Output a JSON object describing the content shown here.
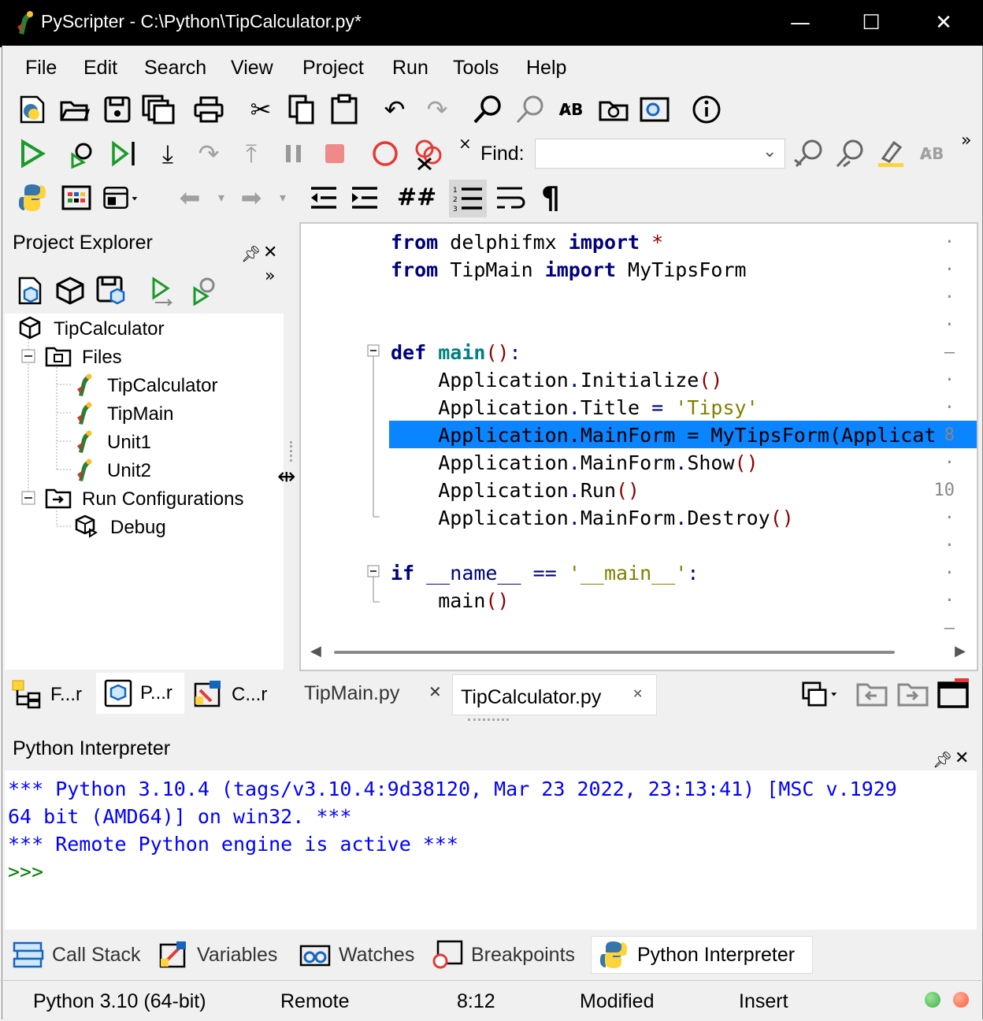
{
  "window": {
    "title": "PyScripter - C:\\Python\\TipCalculator.py*",
    "minimize": "—",
    "maximize": "☐",
    "close": "✕"
  },
  "menu": [
    "File",
    "Edit",
    "Search",
    "View",
    "Project",
    "Run",
    "Tools",
    "Help"
  ],
  "toolbar": {
    "find_label": "Find:",
    "find_value": "",
    "overflow": "»",
    "close": "×"
  },
  "project_explorer": {
    "title": "Project Explorer",
    "overflow": "»",
    "tree": {
      "root": "TipCalculator",
      "files_folder": "Files",
      "files": [
        "TipCalculator",
        "TipMain",
        "Unit1",
        "Unit2"
      ],
      "run_folder": "Run Configurations",
      "run_items": [
        "Debug"
      ]
    },
    "tabs": [
      "F...r",
      "P...r",
      "C...r"
    ]
  },
  "editor": {
    "lines": [
      {
        "no": "·",
        "html_parts": [
          [
            "kw",
            "from"
          ],
          [
            "t",
            " delphifmx "
          ],
          [
            "kw",
            "import"
          ],
          [
            "t",
            " "
          ],
          [
            "paren",
            "*"
          ]
        ]
      },
      {
        "no": "·",
        "html_parts": [
          [
            "kw",
            "from"
          ],
          [
            "t",
            " TipMain "
          ],
          [
            "kw",
            "import"
          ],
          [
            "t",
            " MyTipsForm"
          ]
        ]
      },
      {
        "no": "·",
        "html_parts": []
      },
      {
        "no": "·",
        "html_parts": []
      },
      {
        "no": "–",
        "html_parts": [
          [
            "kw",
            "def"
          ],
          [
            "t",
            " "
          ],
          [
            "fn",
            "main"
          ],
          [
            "paren",
            "()"
          ],
          [
            "op",
            ":"
          ]
        ]
      },
      {
        "no": "·",
        "html_parts": [
          [
            "t",
            "    Application"
          ],
          [
            "op",
            "."
          ],
          [
            "t",
            "Initialize"
          ],
          [
            "paren",
            "()"
          ]
        ]
      },
      {
        "no": "·",
        "html_parts": [
          [
            "t",
            "    Application"
          ],
          [
            "op",
            "."
          ],
          [
            "t",
            "Title "
          ],
          [
            "op",
            "="
          ],
          [
            "t",
            " "
          ],
          [
            "str",
            "'Tipsy'"
          ]
        ]
      },
      {
        "no": "8",
        "html_parts": [
          [
            "t",
            "    Application"
          ],
          [
            "op",
            "."
          ],
          [
            "t",
            "MainForm "
          ],
          [
            "op",
            "="
          ],
          [
            "t",
            " MyTipsForm"
          ],
          [
            "paren",
            "("
          ],
          [
            "t",
            "Applicat"
          ]
        ]
      },
      {
        "no": "·",
        "html_parts": [
          [
            "t",
            "    Application"
          ],
          [
            "op",
            "."
          ],
          [
            "t",
            "MainForm"
          ],
          [
            "op",
            "."
          ],
          [
            "t",
            "Show"
          ],
          [
            "paren",
            "()"
          ]
        ]
      },
      {
        "no": "10",
        "html_parts": [
          [
            "t",
            "    Application"
          ],
          [
            "op",
            "."
          ],
          [
            "t",
            "Run"
          ],
          [
            "paren",
            "()"
          ]
        ]
      },
      {
        "no": "·",
        "html_parts": [
          [
            "t",
            "    Application"
          ],
          [
            "op",
            "."
          ],
          [
            "t",
            "MainForm"
          ],
          [
            "op",
            "."
          ],
          [
            "t",
            "Destroy"
          ],
          [
            "paren",
            "()"
          ]
        ]
      },
      {
        "no": "·",
        "html_parts": []
      },
      {
        "no": "·",
        "html_parts": [
          [
            "kw",
            "if"
          ],
          [
            "t",
            " "
          ],
          [
            "op",
            "__name__"
          ],
          [
            "t",
            " "
          ],
          [
            "op",
            "=="
          ],
          [
            "t",
            " "
          ],
          [
            "str",
            "'__main__'"
          ],
          [
            "op",
            ":"
          ]
        ]
      },
      {
        "no": "·",
        "html_parts": [
          [
            "t",
            "    main"
          ],
          [
            "paren",
            "()"
          ]
        ]
      },
      {
        "no": "–",
        "html_parts": []
      }
    ],
    "tabs": [
      {
        "label": "TipMain.py",
        "close": "✕"
      },
      {
        "label": "TipCalculator.py",
        "close": "✕"
      }
    ]
  },
  "interpreter": {
    "title": "Python Interpreter",
    "lines": [
      "*** Python 3.10.4 (tags/v3.10.4:9d38120, Mar 23 2022, 23:13:41) [MSC v.1929",
      "64 bit (AMD64)] on win32. ***",
      "*** Remote Python engine is active ***"
    ],
    "prompt": ">>>"
  },
  "bottom_tabs": [
    "Call Stack",
    "Variables",
    "Watches",
    "Breakpoints",
    "Python Interpreter"
  ],
  "status": {
    "python": "Python 3.10 (64-bit)",
    "engine": "Remote",
    "position": "8:12",
    "modified": "Modified",
    "mode": "Insert"
  },
  "colors": {
    "highlight": "#0a84ff",
    "keyword": "#000080",
    "string": "#808000",
    "interpreter_text": "#0000ff",
    "prompt": "#008000",
    "status_green": "#3cb043",
    "status_red": "#ff5a3c"
  }
}
